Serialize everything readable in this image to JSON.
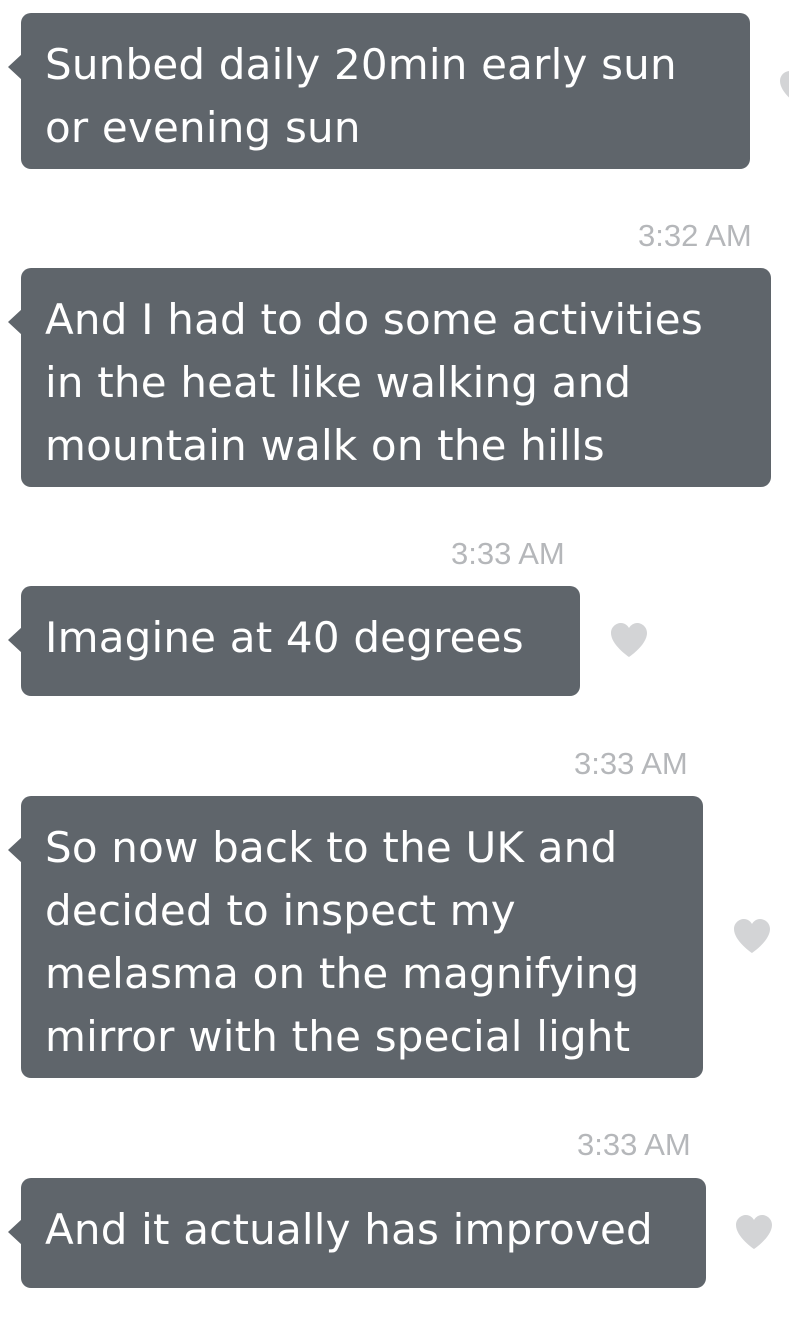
{
  "colors": {
    "bubble": "#5f656b",
    "bubble_text": "#ffffff",
    "timestamp": "#b5b7ba",
    "heart": "#d3d4d6"
  },
  "messages": [
    {
      "sender": "",
      "time": "",
      "text": "Sunbed daily 20min early sun\nor evening sun",
      "heart_icon": "heart-icon"
    },
    {
      "sender": "",
      "time": "3:32 AM",
      "text": "And I had to do some activities\nin the heat like walking and\nmountain walk on the hills"
    },
    {
      "sender": "",
      "time": "3:33 AM",
      "text": "Imagine at 40 degrees",
      "heart_icon": "heart-icon"
    },
    {
      "sender": "",
      "time": "3:33 AM",
      "text": "So now back to the UK and\ndecided to inspect my\nmelasma on the magnifying\nmirror with the special light",
      "heart_icon": "heart-icon"
    },
    {
      "sender": "",
      "time": "3:33 AM",
      "text": "And it actually has improved",
      "heart_icon": "heart-icon"
    }
  ]
}
